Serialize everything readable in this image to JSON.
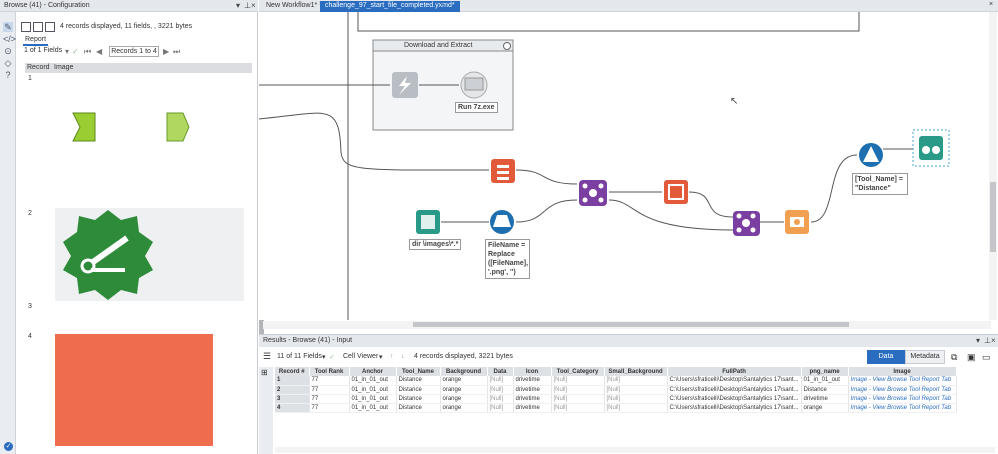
{
  "left_panel": {
    "title": "Browse (41) - Configuration",
    "records_info": "4 records displayed, 11 fields, , 3221 bytes",
    "report_tab": "Report",
    "fields_dropdown": "1 of 1 Fields",
    "record_range": "Records 1 to 4",
    "col_record": "Record",
    "col_image": "Image",
    "rows": [
      "1",
      "2",
      "3",
      "4"
    ],
    "image4_color": "#f06c4e",
    "image2_color": "#2e8b3a",
    "arrow_color": "#9acd32"
  },
  "tabs": [
    {
      "label": "New Workflow1*"
    },
    {
      "label": "challenge_97_start_file_completed.yxmd*"
    }
  ],
  "canvas": {
    "container_title": "Download and Extract",
    "run_label": "Run 7z.exe",
    "dir_label": "dir \\images\\*.*",
    "formula_label": "FileName = Replace ([FileName], '.png', '')",
    "formula_lines": [
      "FileName =",
      "Replace",
      "([FileName],",
      "'.png', '')"
    ],
    "filter_lines": [
      "[Tool_Name] =",
      "\"Distance\""
    ]
  },
  "results": {
    "title": "Results - Browse (41) - Input",
    "fields_dropdown": "11 of 11 Fields",
    "cell_viewer": "Cell Viewer",
    "records_info": "4 records displayed, 3221 bytes",
    "data_btn": "Data",
    "metadata_btn": "Metadata",
    "columns": [
      "Record #",
      "Tool Rank",
      "Anchor",
      "Tool_Name",
      "Background",
      "Data",
      "Icon",
      "Tool_Category",
      "Small_Background",
      "FullPath",
      "png_name",
      "Image"
    ],
    "rows": [
      [
        "1",
        "77",
        "01_in_01_out",
        "Distance",
        "orange",
        "[Null]",
        "drivetime",
        "[Null]",
        "[Null]",
        "C:\\Users\\sfraticelli\\Desktop\\Santalytics 17\\sant...",
        "01_in_01_out",
        "Image - View Browse Tool Report Tab"
      ],
      [
        "2",
        "77",
        "01_in_01_out",
        "Distance",
        "orange",
        "[Null]",
        "drivetime",
        "[Null]",
        "[Null]",
        "C:\\Users\\sfraticelli\\Desktop\\Santalytics 17\\sant...",
        "Distance",
        "Image - View Browse Tool Report Tab"
      ],
      [
        "3",
        "77",
        "01_in_01_out",
        "Distance",
        "orange",
        "[Null]",
        "drivetime",
        "[Null]",
        "[Null]",
        "C:\\Users\\sfraticelli\\Desktop\\Santalytics 17\\sant...",
        "drivetime",
        "Image - View Browse Tool Report Tab"
      ],
      [
        "4",
        "77",
        "01_in_01_out",
        "Distance",
        "orange",
        "[Null]",
        "drivetime",
        "[Null]",
        "[Null]",
        "C:\\Users\\sfraticelli\\Desktop\\Santalytics 17\\sant...",
        "orange",
        "Image - View Browse Tool Report Tab"
      ]
    ]
  }
}
